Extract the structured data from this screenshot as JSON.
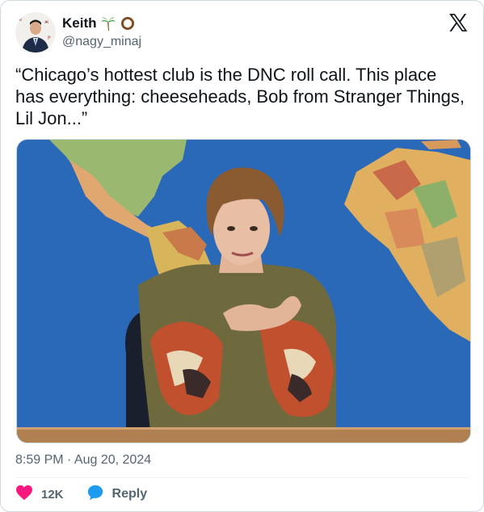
{
  "author": {
    "display_name": "Keith",
    "handle": "@nagy_minaj",
    "avatar_icon": "profile-photo",
    "name_emojis": [
      "palm-tree-icon",
      "coconut-icon"
    ]
  },
  "tweet": {
    "text": "“Chicago’s hottest club is the DNC roll call. This place has everything: cheeseheads, Bob from Stranger Things, Lil Jon...”",
    "timestamp": "8:59 PM · Aug 20, 2024"
  },
  "actions": {
    "like_count": "12K",
    "reply_label": "Reply"
  },
  "colors": {
    "like": "#f91880",
    "reply": "#1d9bf0",
    "secondary_text": "#536471",
    "map_ocean": "#2a68b8"
  }
}
